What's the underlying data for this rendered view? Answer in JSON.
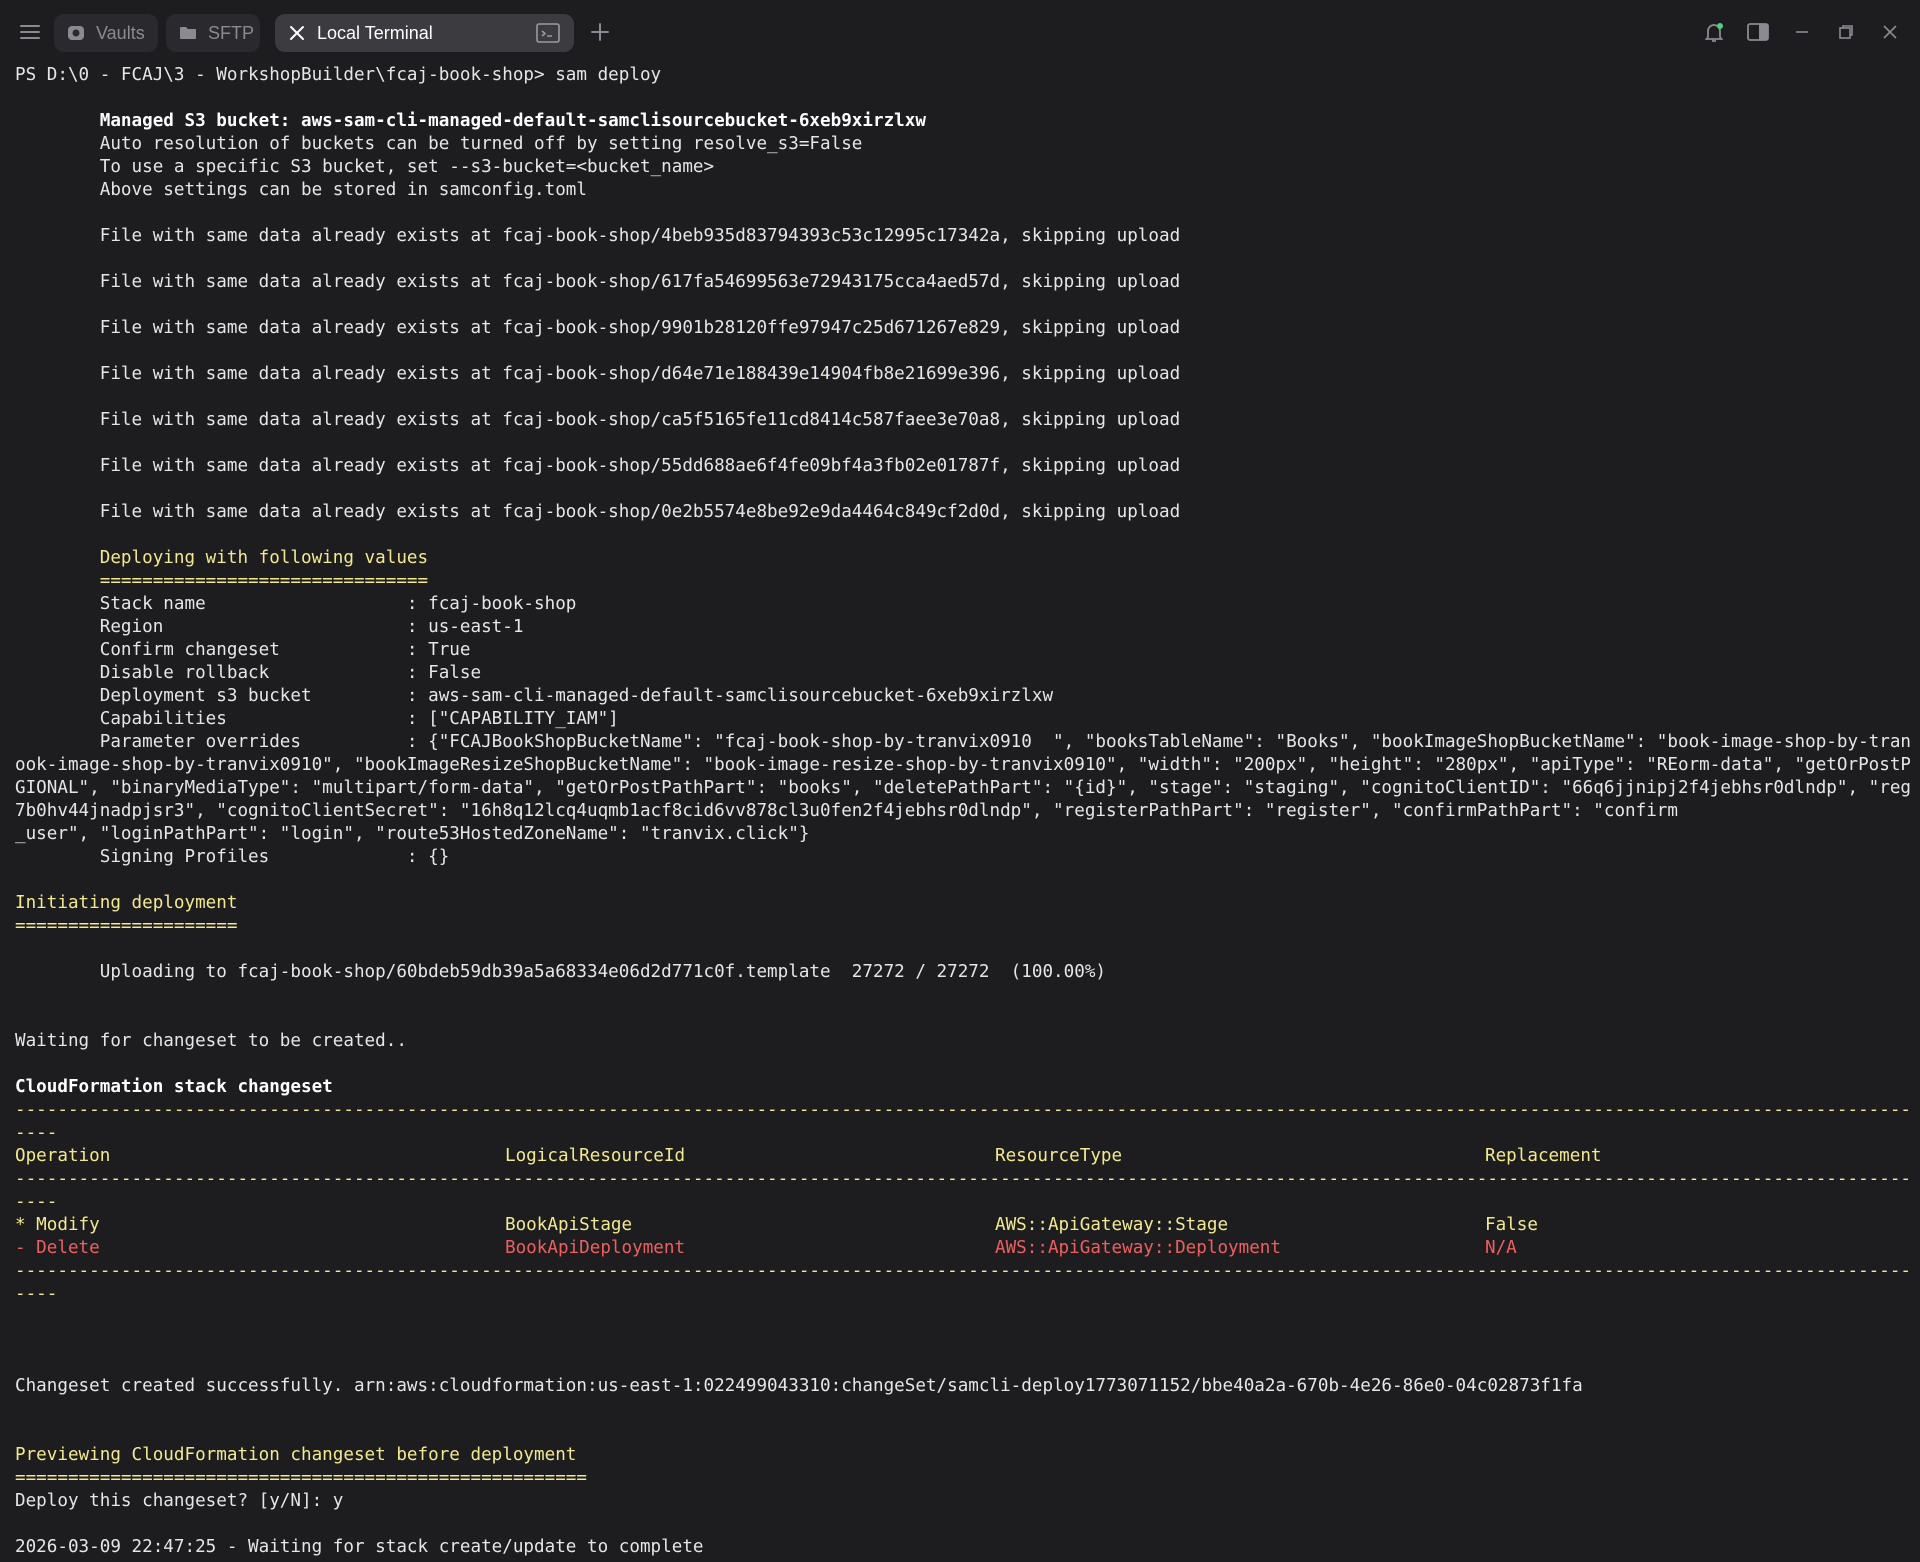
{
  "tabs": {
    "vaults": "Vaults",
    "sftp": "SFTP",
    "local": "Local Terminal"
  },
  "lines": {
    "prompt": "PS D:\\0 - FCAJ\\3 - WorkshopBuilder\\fcaj-book-shop> sam deploy",
    "s3_managed": "        Managed S3 bucket: aws-sam-cli-managed-default-samclisourcebucket-6xeb9xirzlxw",
    "s3_auto": "        Auto resolution of buckets can be turned off by setting resolve_s3=False",
    "s3_specific": "        To use a specific S3 bucket, set --s3-bucket=<bucket_name>",
    "s3_settings": "        Above settings can be stored in samconfig.toml",
    "file1": "        File with same data already exists at fcaj-book-shop/4beb935d83794393c53c12995c17342a, skipping upload",
    "file2": "        File with same data already exists at fcaj-book-shop/617fa54699563e72943175cca4aed57d, skipping upload",
    "file3": "        File with same data already exists at fcaj-book-shop/9901b28120ffe97947c25d671267e829, skipping upload",
    "file4": "        File with same data already exists at fcaj-book-shop/d64e71e188439e14904fb8e21699e396, skipping upload",
    "file5": "        File with same data already exists at fcaj-book-shop/ca5f5165fe11cd8414c587faee3e70a8, skipping upload",
    "file6": "        File with same data already exists at fcaj-book-shop/55dd688ae6f4fe09bf4a3fb02e01787f, skipping upload",
    "file7": "        File with same data already exists at fcaj-book-shop/0e2b5574e8be92e9da4464c849cf2d0d, skipping upload",
    "deploying_title": "        Deploying with following values",
    "deploying_rule": "        ===============================",
    "stack_name": "        Stack name                   : fcaj-book-shop",
    "region": "        Region                       : us-east-1",
    "confirm": "        Confirm changeset            : True",
    "disable_rb": "        Disable rollback             : False",
    "deploy_bucket": "        Deployment s3 bucket         : aws-sam-cli-managed-default-samclisourcebucket-6xeb9xirzlxw",
    "capabilities": "        Capabilities                 : [\"CAPABILITY_IAM\"]",
    "param1": "        Parameter overrides          : {\"FCAJBookShopBucketName\": \"fcaj-book-shop-by-tranvix0910  \", \"booksTableName\": \"Books\", \"bookImageShopBucketName\": \"book-image-shop-by-tranvix0910\", \"b",
    "param2": "ook-image-shop-by-tranvix0910\", \"bookImageResizeShopBucketName\": \"book-image-resize-shop-by-tranvix0910\", \"width\": \"200px\", \"height\": \"280px\", \"apiType\": \"REorm-data\", \"getOrPostPathPart\": \"",
    "param3": "GIONAL\", \"binaryMediaType\": \"multipart/form-data\", \"getOrPostPathPart\": \"books\", \"deletePathPart\": \"{id}\", \"stage\": \"staging\", \"cognitoClientID\": \"66q6jjnipj2f4jebhsr0dlndp\", \"registerPathP",
    "param4": "7b0hv44jnadpjsr3\", \"cognitoClientSecret\": \"16h8q12lcq4uqmb1acf8cid6vv878cl3u0fen2f4jebhsr0dlndp\", \"registerPathPart\": \"register\", \"confirmPathPart\": \"confirm",
    "param5": "_user\", \"loginPathPart\": \"login\", \"route53HostedZoneName\": \"tranvix.click\"}",
    "signing": "        Signing Profiles             : {}",
    "initiating": "Initiating deployment",
    "initiating_rule": "=====================",
    "uploading": "        Uploading to fcaj-book-shop/60bdeb59db39a5a68334e06d2d771c0f.template  27272 / 27272  (100.00%)",
    "waiting_cs": "Waiting for changeset to be created..",
    "cf_title": "CloudFormation stack changeset",
    "dash_long": "-------------------------------------------------------------------------------------------------------------------------------------------------------------------------------------------------",
    "dash_short": "----",
    "changeset_ok": "Changeset created successfully. arn:aws:cloudformation:us-east-1:022499043310:changeSet/samcli-deploy1773071152/bbe40a2a-670b-4e26-86e0-04c02873f1fa",
    "previewing": "Previewing CloudFormation changeset before deployment",
    "previewing_rule": "======================================================",
    "deploy_q": "Deploy this changeset? [y/N]: y",
    "waiting_stack": "2026-03-09 22:47:25 - Waiting for stack create/update to complete"
  },
  "changeset_table": {
    "headers": [
      "Operation",
      "LogicalResourceId",
      "ResourceType",
      "Replacement"
    ],
    "rows": [
      [
        "* Modify",
        "BookApiStage",
        "AWS::ApiGateway::Stage",
        "False"
      ],
      [
        "- Delete",
        "BookApiDeployment",
        "AWS::ApiGateway::Deployment",
        "N/A"
      ]
    ]
  },
  "colors": {
    "background": "#1d1d20",
    "text": "#e6e6e6",
    "yellow": "#f3e98f",
    "red": "#ef5f5f",
    "active_tab": "#3b3b40"
  },
  "icons": [
    "menu-icon",
    "vaults-icon",
    "folder-icon",
    "close-icon",
    "terminal-icon",
    "plus-icon",
    "bell-icon",
    "sidebar-icon",
    "minimize-icon",
    "restore-icon",
    "window-close-icon"
  ]
}
